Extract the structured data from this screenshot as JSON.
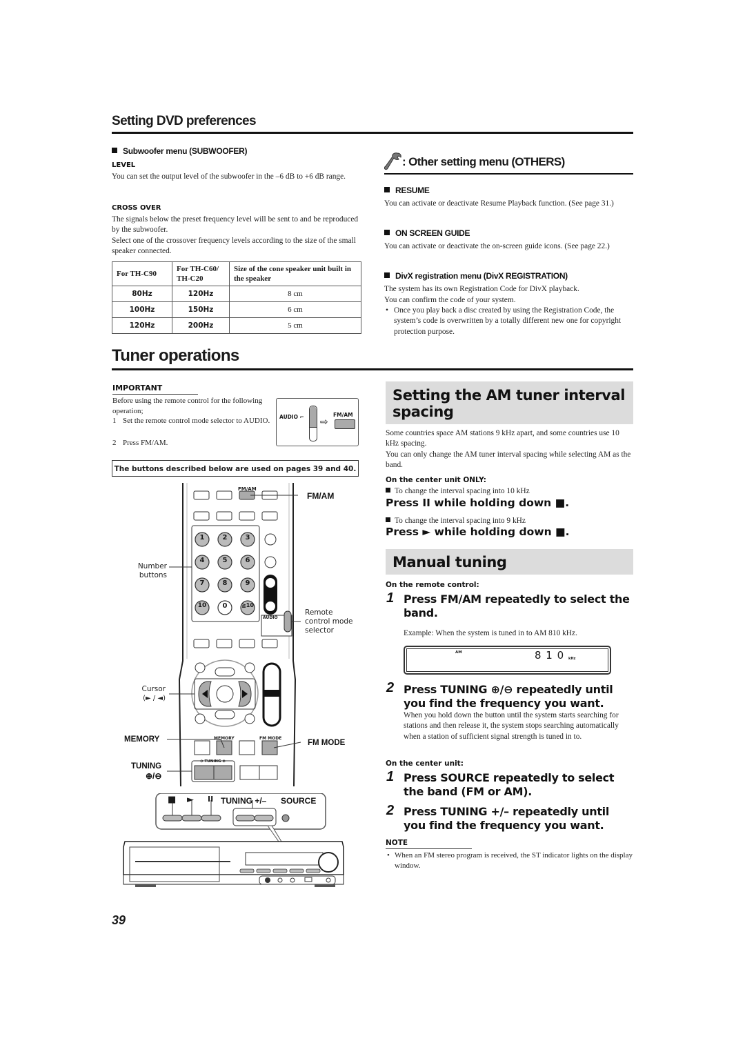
{
  "dvd_prefs": {
    "title": "Setting DVD preferences",
    "subwoofer": {
      "heading": "Subwoofer menu (SUBWOOFER)",
      "level_label": "LEVEL",
      "level_text": "You can set the output level of the subwoofer in the –6 dB to +6 dB range.",
      "crossover_label": "CROSS OVER",
      "crossover_text_1": "The signals below the preset frequency level will be sent to and be reproduced by the subwoofer.",
      "crossover_text_2": "Select one of the crossover frequency levels according to the size of the small speaker connected.",
      "table": {
        "headers": [
          "For TH-C90",
          "For TH-C60/ TH-C20",
          "Size of the cone speaker unit built in the speaker"
        ],
        "rows": [
          [
            "80Hz",
            "120Hz",
            "8 cm"
          ],
          [
            "100Hz",
            "150Hz",
            "6 cm"
          ],
          [
            "120Hz",
            "200Hz",
            "5 cm"
          ]
        ]
      }
    },
    "others": {
      "heading": ": Other setting menu (OTHERS)",
      "icon": "wrench-icon",
      "items": [
        {
          "label": "RESUME",
          "text": "You can activate or deactivate Resume Playback function. (See page 31.)"
        },
        {
          "label": "ON SCREEN GUIDE",
          "text": "You can activate or deactivate the on-screen guide icons. (See page 22.)"
        }
      ],
      "divx": {
        "label": "DivX registration menu (DivX REGISTRATION)",
        "text_1": "The system has its own Registration Code for DivX playback.",
        "text_2": "You can confirm the code of your system.",
        "bullet": "Once you play back a disc created by using the Registration Code, the system’s code is overwritten by a totally different new one for copyright protection purpose."
      }
    }
  },
  "tuner": {
    "title": "Tuner operations",
    "important": {
      "label": "IMPORTANT",
      "intro": "Before using the remote control for the following operation;",
      "steps": [
        {
          "num": "1",
          "text": "Set the remote control mode selector to AUDIO."
        },
        {
          "num": "2",
          "text": "Press FM/AM."
        }
      ],
      "diagram_audio": "AUDIO",
      "diagram_fmam": "FM/AM"
    },
    "pages_note": "The buttons described below are used on pages 39 and 40.",
    "remote": {
      "fmam_small": "FM/AM",
      "fmam_callout": "FM/AM",
      "number_buttons_callout": "Number buttons",
      "number_keys": [
        "1",
        "2",
        "3",
        "4",
        "5",
        "6",
        "7",
        "8",
        "9",
        "10",
        "0",
        "≧10"
      ],
      "audio_small": "AUDIO",
      "mode_selector_callout": "Remote control mode selector",
      "cursor_callout": "Cursor",
      "cursor_sub": "(► / ◄)",
      "memory_callout": "MEMORY",
      "memory_small": "MEMORY",
      "fm_mode_small": "FM MODE",
      "fm_mode_callout": "FM MODE",
      "tuning_callout": "TUNING",
      "tuning_sub": "⊕/⊖",
      "tuning_small": "⊖ TUNING ⊕"
    },
    "center_unit": {
      "stop": "■",
      "play": "►",
      "pause": "II",
      "tuning": "TUNING +/–",
      "source": "SOURCE"
    },
    "am_spacing": {
      "title": "Setting the AM tuner interval spacing",
      "text_1": "Some countries space AM stations 9 kHz apart, and some countries use 10 kHz spacing.",
      "text_2": "You can only change the AM tuner interval spacing while selecting AM as the band.",
      "center_only": "On the center unit ONLY:",
      "to_10": "To change the interval spacing into 10 kHz",
      "press_10": "Press II while holding down ■.",
      "to_9": "To change the interval spacing into 9 kHz",
      "press_9": "Press ► while holding down ■."
    },
    "manual": {
      "title": "Manual tuning",
      "remote_label": "On the remote control:",
      "remote_steps": [
        {
          "num": "1",
          "text": "Press FM/AM repeatedly to select the band."
        },
        {
          "num": "2",
          "text": "Press TUNING ⊕/⊖ repeatedly until you find the frequency you want."
        }
      ],
      "example": "Example: When the system is tuned in to AM 810 kHz.",
      "display": {
        "band": "AM",
        "freq": "8 1 0",
        "unit": "kHz"
      },
      "hold_text": "When you hold down the button until the system starts searching for stations and then release it, the system stops searching automatically when a station of sufficient signal strength is tuned in to.",
      "center_label": "On the center unit:",
      "center_steps": [
        {
          "num": "1",
          "text": "Press SOURCE repeatedly to select the band (FM or AM)."
        },
        {
          "num": "2",
          "text": "Press TUNING +/– repeatedly until you find the frequency you want."
        }
      ],
      "note_label": "NOTE",
      "note_text": "When an FM stereo program is received, the ST indicator lights on the display window."
    }
  },
  "page_number": "39"
}
